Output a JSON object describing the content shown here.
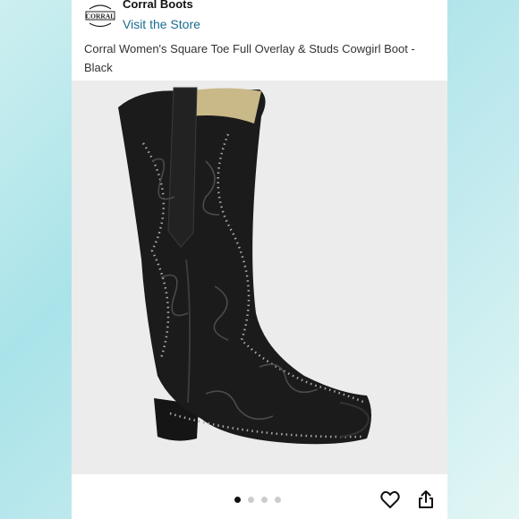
{
  "store": {
    "name": "Corral Boots",
    "visit_label": "Visit the Store",
    "logo_text": "CORRAL"
  },
  "product": {
    "title": "Corral Women's Square Toe Full Overlay & Studs Cowgirl Boot - Black"
  },
  "gallery": {
    "image_count": 4,
    "active_index": 0
  },
  "actions": {
    "favorite_icon": "heart-icon",
    "share_icon": "share-icon"
  },
  "colors": {
    "link": "#1a6d8f",
    "active_dot": "#111111",
    "inactive_dot": "#cccccc"
  }
}
